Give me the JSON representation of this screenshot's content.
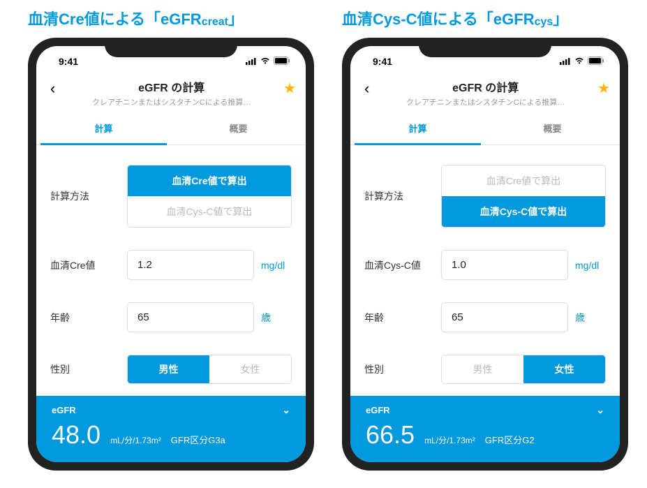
{
  "headlines": {
    "left_pre": "血清Cre値による「eGFR",
    "left_sub": "creat",
    "left_post": "」",
    "right_pre": "血清Cys-C値による「eGFR",
    "right_sub": "cys",
    "right_post": "」"
  },
  "status": {
    "time": "9:41"
  },
  "header": {
    "title": "eGFR の計算",
    "subtitle": "クレアチニンまたはシスタチンCによる推算…"
  },
  "tabs": {
    "calc": "計算",
    "desc": "概要"
  },
  "labels": {
    "method": "計算方法",
    "cre_value": "血清Cre値",
    "cys_value": "血清Cys-C値",
    "age": "年齢",
    "sex": "性別"
  },
  "method_options": {
    "cre": "血清Cre値で算出",
    "cys": "血清Cys-C値で算出"
  },
  "sex_options": {
    "male": "男性",
    "female": "女性"
  },
  "units": {
    "mgdl": "mg/dl",
    "years": "歳",
    "result": "mL/分/1.73m²"
  },
  "phones": {
    "left": {
      "marker_value": "1.2",
      "age_value": "65",
      "selected_method": "cre",
      "selected_sex": "male",
      "marker_label_key": "cre_value",
      "result_label": "eGFR",
      "result_value": "48.0",
      "result_class": "GFR区分G3a"
    },
    "right": {
      "marker_value": "1.0",
      "age_value": "65",
      "selected_method": "cys",
      "selected_sex": "female",
      "marker_label_key": "cys_value",
      "result_label": "eGFR",
      "result_value": "66.5",
      "result_class": "GFR区分G2"
    }
  }
}
